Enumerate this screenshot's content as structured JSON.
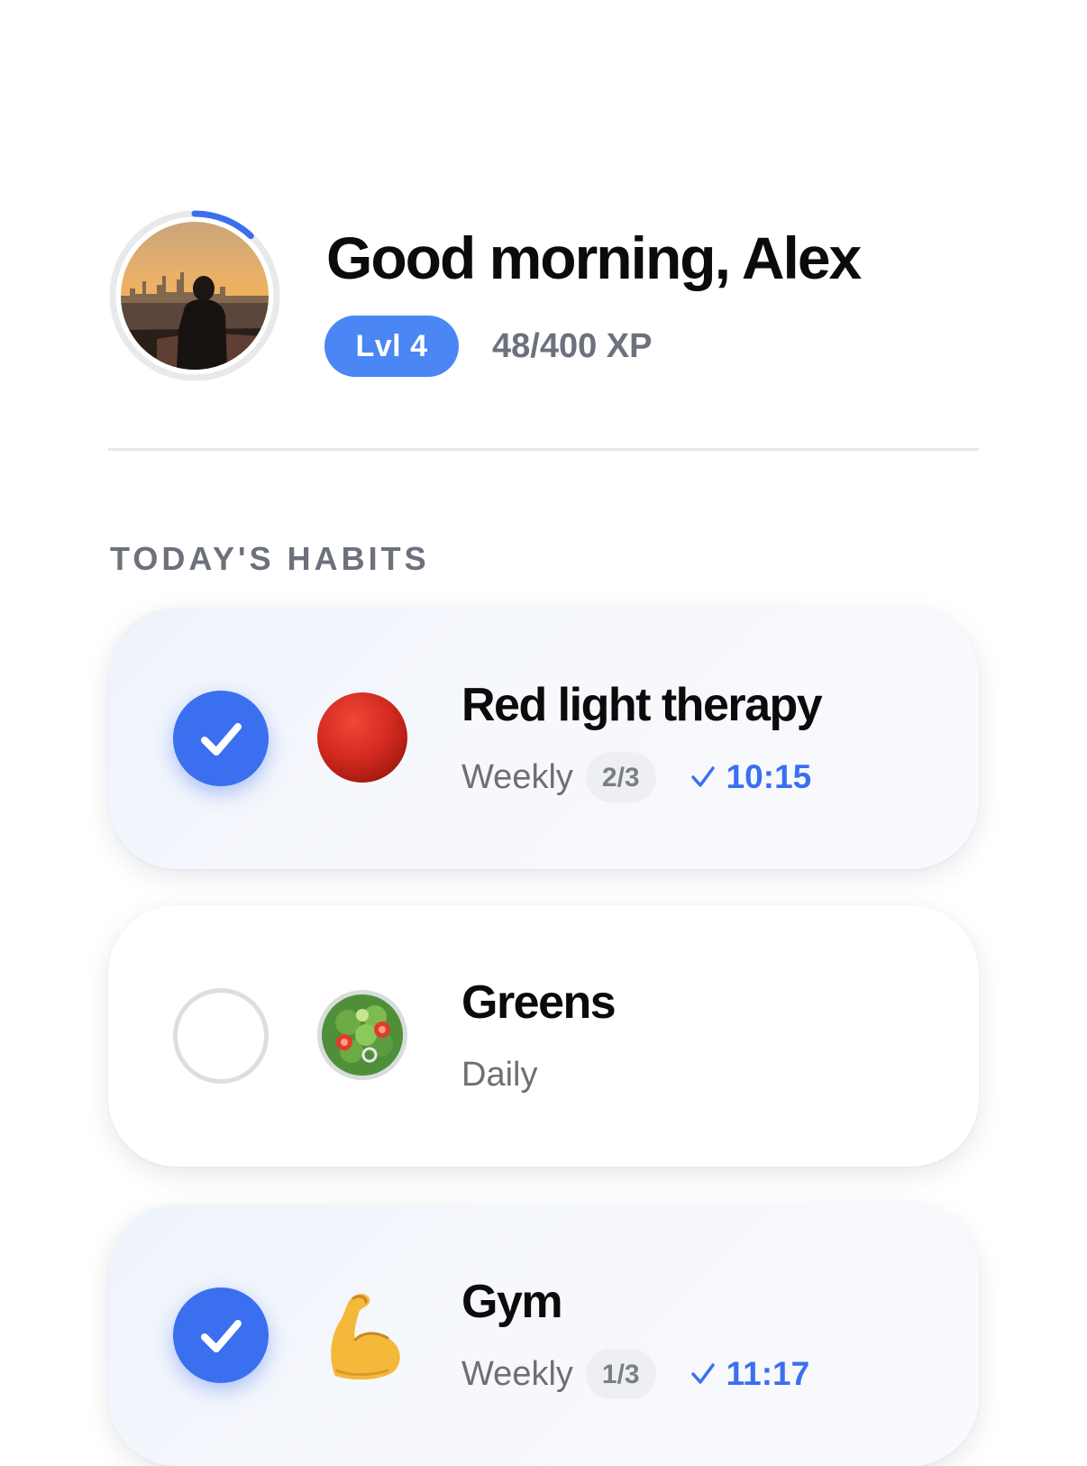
{
  "header": {
    "greeting": "Good morning, Alex",
    "level_label": "Lvl 4",
    "xp_label": "48/400 XP",
    "xp_current": 48,
    "xp_total": 400
  },
  "section": {
    "title": "TODAY'S HABITS"
  },
  "habits": [
    {
      "name": "Red light therapy",
      "emoji": "red-circle-icon",
      "frequency": "Weekly",
      "count": "2/3",
      "completed": true,
      "completed_time": "10:15"
    },
    {
      "name": "Greens",
      "emoji": "salad-icon",
      "frequency": "Daily",
      "completed": false
    },
    {
      "name": "Gym",
      "emoji": "flexed-biceps-icon",
      "frequency": "Weekly",
      "count": "1/3",
      "completed": true,
      "completed_time": "11:17"
    }
  ],
  "colors": {
    "accent": "#3a6ff0",
    "badge": "#4a86f4",
    "muted_text": "#6c717c"
  }
}
